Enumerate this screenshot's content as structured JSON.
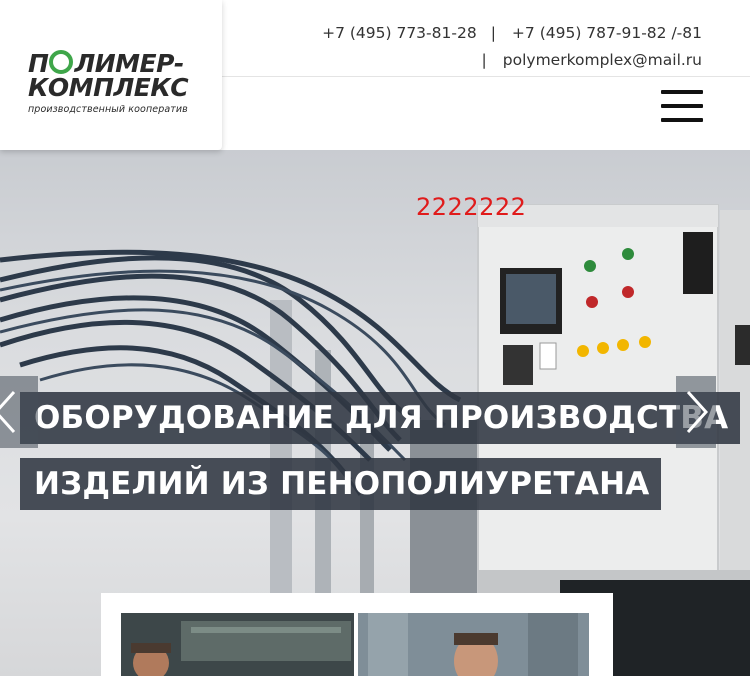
{
  "header": {
    "logo": {
      "line1": "ПОЛИМЕР-",
      "line2": "КОМПЛЕКС",
      "subtitle": "производственный кооператив",
      "accent_color": "#3fa64a"
    },
    "contacts": {
      "phone1": "+7 (495) 773-81-28",
      "separator": "|",
      "phone2": "+7 (495) 787-91-82 /-81",
      "email": "polymerkomplex@mail.ru"
    },
    "menu_icon": "hamburger-icon"
  },
  "hero": {
    "red_text": "2222222",
    "red_color": "#e01b1b",
    "title_line1": "ОБОРУДОВАНИЕ ДЛЯ ПРОИЗВОДСТВА",
    "title_line2": "ИЗДЕЛИЙ ИЗ ПЕНОПОЛИУРЕТАНА",
    "prev_icon": "chevron-left-icon",
    "next_icon": "chevron-right-icon"
  }
}
